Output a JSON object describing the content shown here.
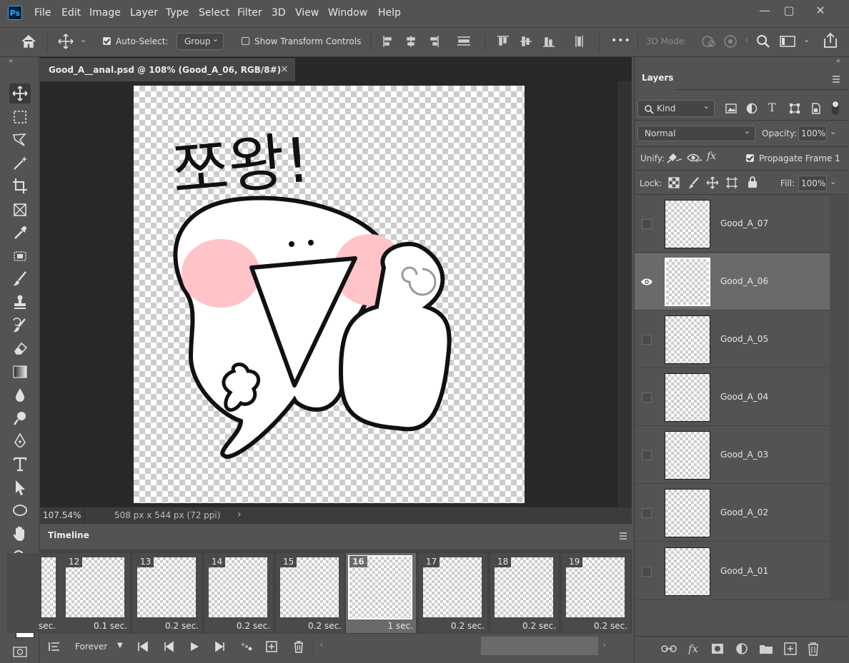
{
  "app": {
    "logo": "Ps"
  },
  "menu": [
    "File",
    "Edit",
    "Image",
    "Layer",
    "Type",
    "Select",
    "Filter",
    "3D",
    "View",
    "Window",
    "Help"
  ],
  "window_controls": {
    "minimize": "—",
    "maximize": "▢",
    "close": "✕"
  },
  "options": {
    "auto_select_label": "Auto-Select:",
    "auto_select_value": "Group",
    "show_transform_label": "Show Transform Controls",
    "mode_3d_label": "3D Mode:",
    "more": "•••"
  },
  "document": {
    "tab_title": "Good_A__anal.psd @ 108% (Good_A_06, RGB/8#)",
    "close": "×",
    "zoom": "107.54%",
    "dimensions": "508 px x 544 px (72 ppi)",
    "artwork_text": "쪼왕!"
  },
  "timeline": {
    "title": "Timeline",
    "loop": "Forever",
    "frames": [
      {
        "num": "",
        "delay": "sec."
      },
      {
        "num": "12",
        "delay": "0.1 sec."
      },
      {
        "num": "13",
        "delay": "0.2 sec."
      },
      {
        "num": "14",
        "delay": "0.2 sec."
      },
      {
        "num": "15",
        "delay": "0.2 sec."
      },
      {
        "num": "16",
        "delay": "1 sec."
      },
      {
        "num": "17",
        "delay": "0.2 sec."
      },
      {
        "num": "18",
        "delay": "0.2 sec."
      },
      {
        "num": "19",
        "delay": "0.2 sec."
      }
    ],
    "selected_frame": "16"
  },
  "layers_panel": {
    "title": "Layers",
    "filter_kind": "Kind",
    "blend_mode": "Normal",
    "opacity_label": "Opacity:",
    "opacity_value": "100%",
    "unify_label": "Unify:",
    "propagate_label": "Propagate Frame 1",
    "lock_label": "Lock:",
    "fill_label": "Fill:",
    "fill_value": "100%",
    "layers": [
      {
        "name": "Good_A_07",
        "visible": false,
        "selected": false
      },
      {
        "name": "Good_A_06",
        "visible": true,
        "selected": true
      },
      {
        "name": "Good_A_05",
        "visible": false,
        "selected": false
      },
      {
        "name": "Good_A_04",
        "visible": false,
        "selected": false
      },
      {
        "name": "Good_A_03",
        "visible": false,
        "selected": false
      },
      {
        "name": "Good_A_02",
        "visible": false,
        "selected": false
      },
      {
        "name": "Good_A_01",
        "visible": false,
        "selected": false
      }
    ]
  },
  "colors": {
    "foreground": "#ffffff",
    "background": "#a9c4d8",
    "cheek": "#ffc4c8"
  }
}
